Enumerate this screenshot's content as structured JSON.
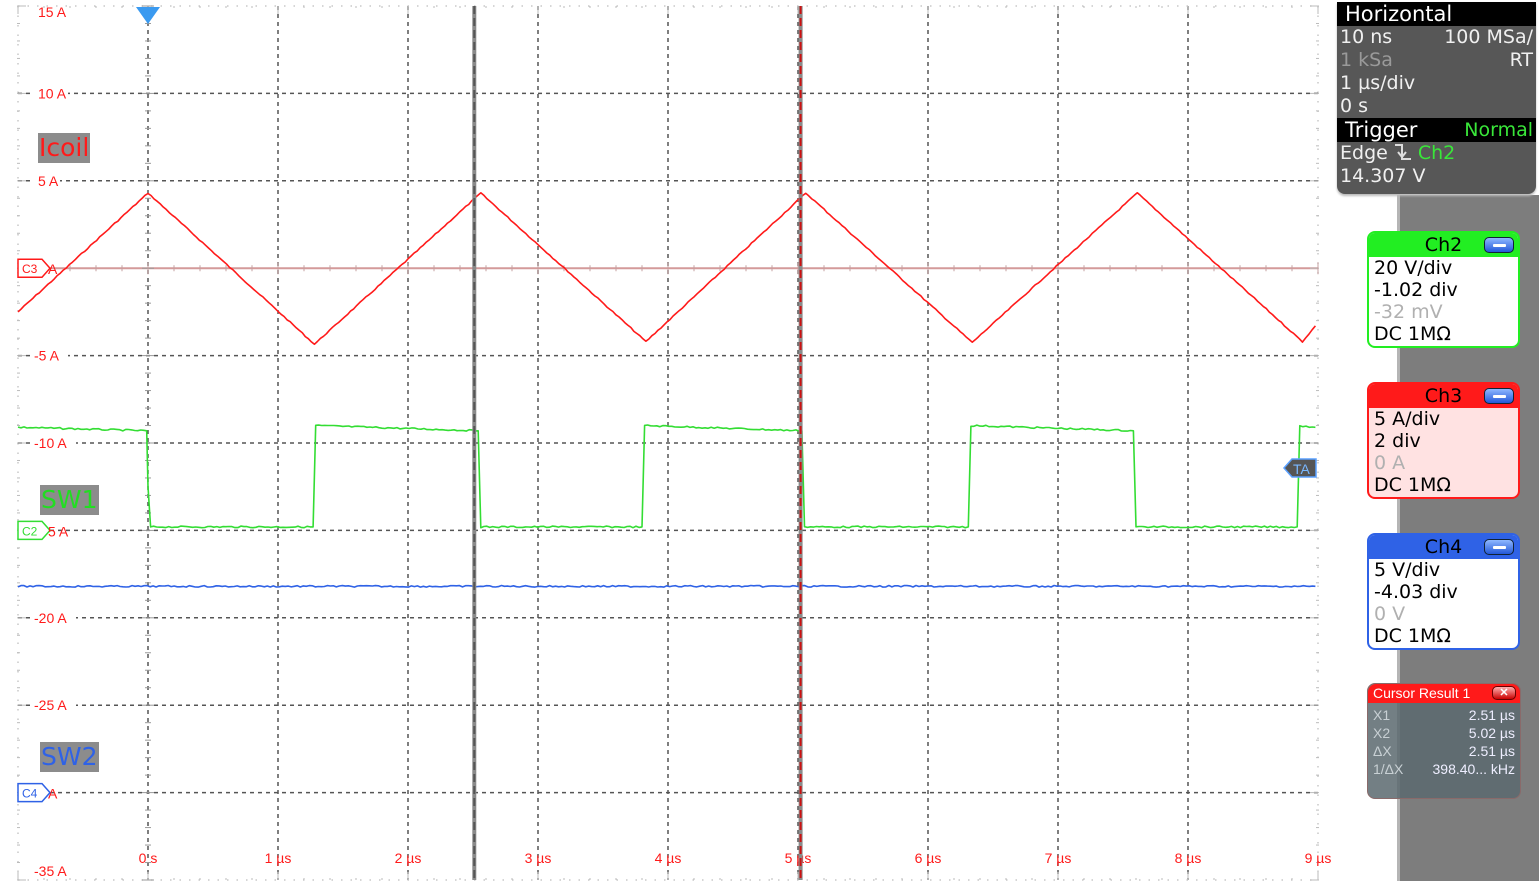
{
  "chart_data": {
    "type": "line",
    "title": "",
    "xlabel": "",
    "ylabel": "",
    "x_unit": "µs",
    "xlim": [
      -1,
      9
    ],
    "ylim": [
      -35,
      15
    ],
    "grid": true,
    "x_ticks": [
      {
        "value": 0,
        "label": "0 s"
      },
      {
        "value": 1,
        "label": "1 µs"
      },
      {
        "value": 2,
        "label": "2 µs"
      },
      {
        "value": 3,
        "label": "3 µs"
      },
      {
        "value": 4,
        "label": "4 µs"
      },
      {
        "value": 5,
        "label": "5 µs"
      },
      {
        "value": 6,
        "label": "6 µs"
      },
      {
        "value": 7,
        "label": "7 µs"
      },
      {
        "value": 8,
        "label": "8 µs"
      },
      {
        "value": 9,
        "label": "9 µs"
      }
    ],
    "y_ticks": [
      {
        "value": 15,
        "label": "15 A"
      },
      {
        "value": 10,
        "label": "10 A"
      },
      {
        "value": 5,
        "label": "5 A"
      },
      {
        "value": -5,
        "label": "-5 A"
      },
      {
        "value": -10,
        "label": "-10 A"
      },
      {
        "value": -20,
        "label": "-20 A"
      },
      {
        "value": -25,
        "label": "-25 A"
      },
      {
        "value": -35,
        "label": "-35 A"
      }
    ],
    "series": [
      {
        "name": "Icoil",
        "channel": "C3",
        "color": "#ff1a1a",
        "unit": "A (screen scale)",
        "x": [
          -1.0,
          0.0,
          1.28,
          2.56,
          3.83,
          5.06,
          6.34,
          7.61,
          8.88,
          8.98
        ],
        "y": [
          -2.5,
          4.3,
          -4.35,
          4.3,
          -4.2,
          4.3,
          -4.25,
          4.3,
          -4.2,
          -3.3
        ]
      },
      {
        "name": "SW1",
        "channel": "C2",
        "color": "#33dd33",
        "unit": "A (screen scale)",
        "x": [
          -1.0,
          -0.01,
          0.0,
          0.02,
          1.27,
          1.29,
          2.54,
          2.56,
          3.8,
          3.82,
          5.03,
          5.05,
          6.31,
          6.33,
          7.58,
          7.6,
          8.84,
          8.86,
          8.98
        ],
        "y": [
          -9.1,
          -9.3,
          -12.5,
          -14.8,
          -14.8,
          -9.0,
          -9.3,
          -14.8,
          -14.8,
          -9.0,
          -9.3,
          -14.8,
          -14.8,
          -9.0,
          -9.3,
          -14.8,
          -14.8,
          -9.0,
          -9.1
        ]
      },
      {
        "name": "SW2",
        "channel": "C4",
        "color": "#2f62e6",
        "unit": "A (screen scale)",
        "x": [
          -1.0,
          8.98
        ],
        "y": [
          -18.2,
          -18.2
        ]
      }
    ],
    "cursors": [
      {
        "name": "X1",
        "x": 2.51,
        "color": "#555555"
      },
      {
        "name": "X2",
        "x": 5.02,
        "color": "#cc1111"
      }
    ],
    "annotations": [
      {
        "text": "Icoil",
        "color": "#ff1a1a"
      },
      {
        "text": "SW1",
        "color": "#22dd22"
      },
      {
        "text": "SW2",
        "color": "#2f62e6"
      }
    ],
    "markers": {
      "c3_marker": "C3",
      "c3_offset": "A",
      "c2_marker": "C2",
      "c2_offset": "5 A",
      "c4_marker": "C4",
      "c4_offset": "A",
      "trigger_level_marker": "TA",
      "trigger_position_marker": "trigger-position-triangle"
    }
  },
  "horizontal": {
    "title": "Horizontal",
    "resolution": "10 ns",
    "sample_rate": "100 MSa/",
    "record_length": "1 kSa",
    "mode": "RT",
    "time_scale": "1 µs/div",
    "position": "0 s"
  },
  "trigger": {
    "title": "Trigger",
    "mode": "Normal",
    "type": "Edge",
    "slope_icon": "falling-edge-icon",
    "source": "Ch2",
    "level": "14.307 V"
  },
  "channels": [
    {
      "name": "Ch2",
      "scale": "20 V/div",
      "position": "-1.02 div",
      "offset": "-32 mV",
      "coupling": "DC 1MΩ",
      "color": "#22ee22"
    },
    {
      "name": "Ch3",
      "scale": "5 A/div",
      "position": "2 div",
      "offset": "0 A",
      "coupling": "DC 1MΩ",
      "color": "#ff1a1a"
    },
    {
      "name": "Ch4",
      "scale": "5 V/div",
      "position": "-4.03 div",
      "offset": "0 V",
      "coupling": "DC 1MΩ",
      "color": "#2f62e6"
    }
  ],
  "cursor_result": {
    "title": "Cursor Result 1",
    "close_label": "✕",
    "rows": [
      {
        "key": "X1",
        "value": "2.51 µs"
      },
      {
        "key": "X2",
        "value": "5.02 µs"
      },
      {
        "key": "ΔX",
        "value": "2.51 µs"
      },
      {
        "key": "1/ΔX",
        "value": "398.40... kHz"
      }
    ]
  }
}
